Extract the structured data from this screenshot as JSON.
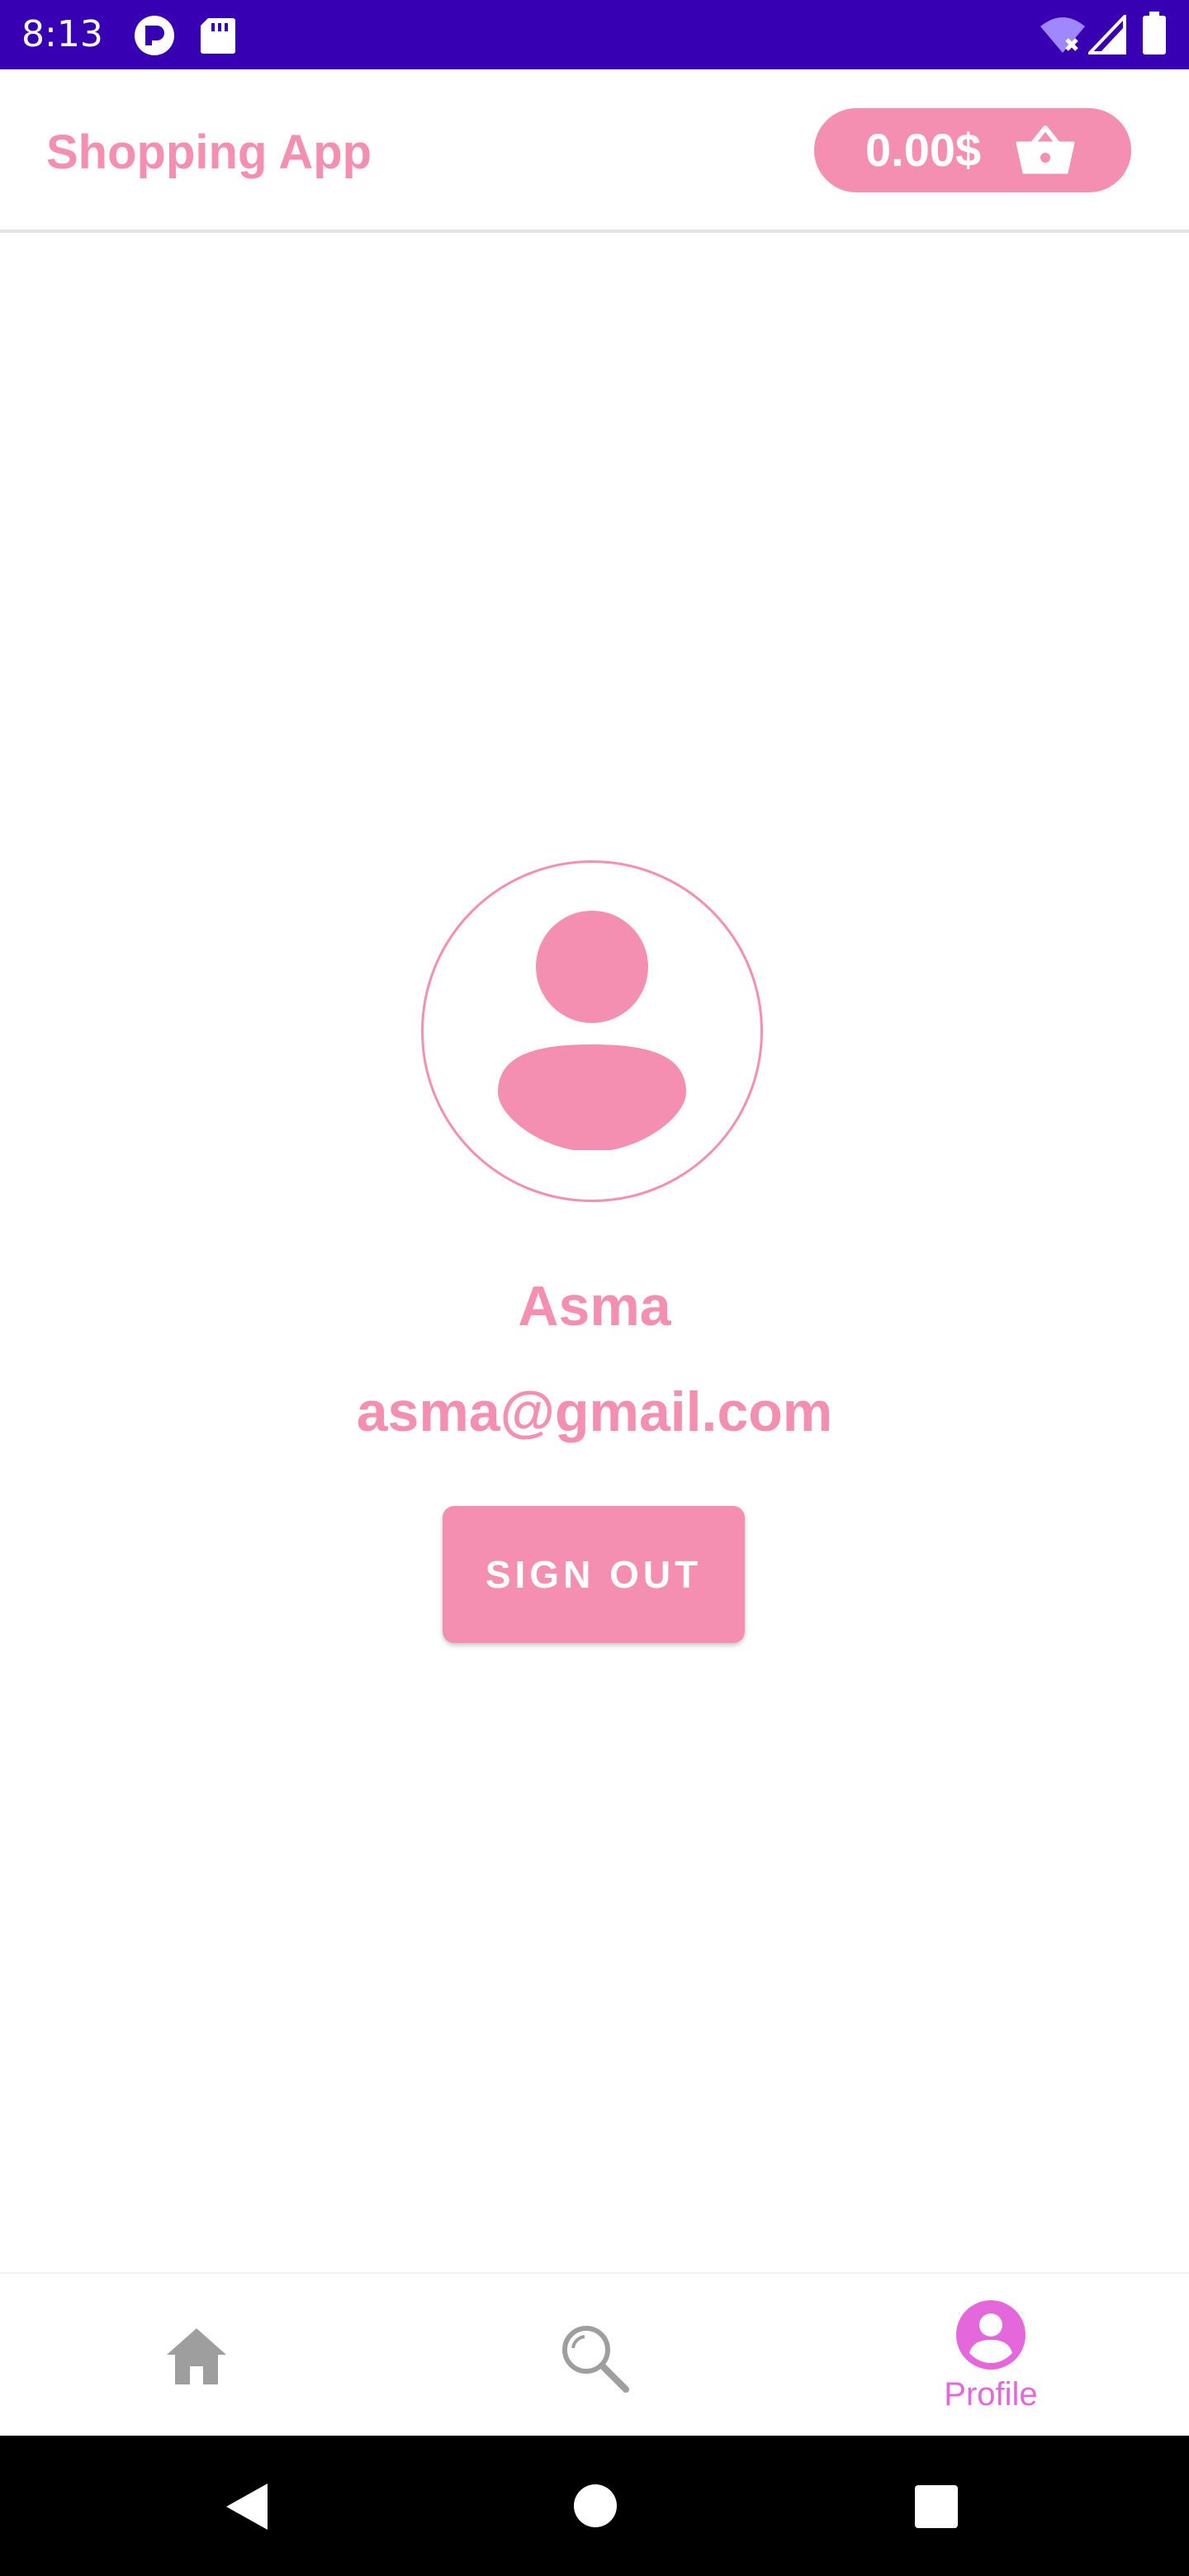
{
  "status_bar": {
    "time": "8:13",
    "icons": [
      "app-notification-icon",
      "sd-card-icon",
      "wifi-icon",
      "cell-signal-icon",
      "battery-icon"
    ]
  },
  "app_bar": {
    "title": "Shopping App",
    "cart_total": "0.00$",
    "cart_icon": "shopping-basket-icon"
  },
  "profile": {
    "avatar_icon": "account-icon",
    "name": "Asma",
    "email": "asma@gmail.com",
    "sign_out_label": "SIGN OUT"
  },
  "bottom_nav": {
    "items": [
      {
        "id": "home",
        "icon": "home-icon",
        "label": "",
        "active": false
      },
      {
        "id": "search",
        "icon": "search-icon",
        "label": "",
        "active": false
      },
      {
        "id": "profile",
        "icon": "account-circle-icon",
        "label": "Profile",
        "active": true
      }
    ]
  },
  "system_nav": {
    "buttons": [
      "back-icon",
      "home-circle-icon",
      "recents-icon"
    ]
  },
  "colors": {
    "status_bar": "#3700b3",
    "accent": "#f48fb1",
    "active_nav": "#e468dc",
    "inactive_nav": "#9e9e9e",
    "system_nav": "#000000"
  }
}
